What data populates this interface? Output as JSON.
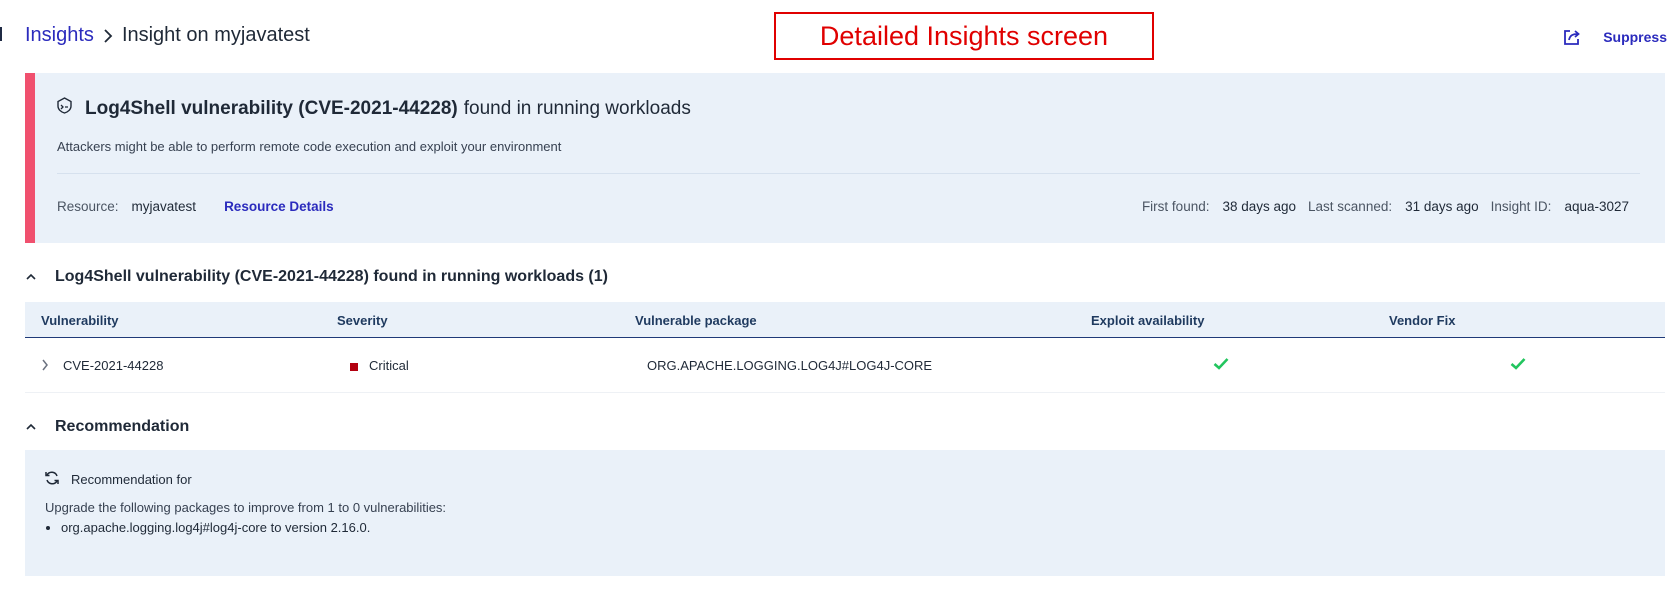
{
  "breadcrumb": {
    "root": "Insights",
    "current": "Insight on myjavatest"
  },
  "annotation": "Detailed Insights screen",
  "header": {
    "share_icon": "share-icon",
    "suppress_label": "Suppress"
  },
  "insight": {
    "title_bold": "Log4Shell vulnerability (CVE-2021-44228)",
    "title_rest": "found in running workloads",
    "description": "Attackers might be able to perform remote code execution and exploit your environment",
    "resource_label": "Resource:",
    "resource_value": "myjavatest",
    "resource_details_link": "Resource Details",
    "first_found_label": "First found:",
    "first_found_value": "38 days ago",
    "last_scanned_label": "Last scanned:",
    "last_scanned_value": "31 days ago",
    "insight_id_label": "Insight ID:",
    "insight_id_value": "aqua-3027",
    "stripe_color": "#f0506e"
  },
  "vuln_section": {
    "title": "Log4Shell vulnerability (CVE-2021-44228) found in running workloads (1)",
    "columns": [
      "Vulnerability",
      "Severity",
      "Vulnerable package",
      "Exploit availability",
      "Vendor Fix"
    ],
    "rows": [
      {
        "vulnerability": "CVE-2021-44228",
        "severity": "Critical",
        "severity_color": "#b30010",
        "package": "ORG.APACHE.LOGGING.LOG4J#LOG4J-CORE",
        "exploit_available": true,
        "vendor_fix": true
      }
    ]
  },
  "recommendation": {
    "title": "Recommendation",
    "heading": "Recommendation for",
    "text": "Upgrade the following packages to improve from 1 to 0 vulnerabilities:",
    "items": [
      "org.apache.logging.log4j#log4j-core to version 2.16.0."
    ]
  },
  "colors": {
    "link": "#2b2bbd",
    "panel_bg": "#eaf1f9",
    "check": "#22c55e",
    "annotation": "#e00000"
  }
}
